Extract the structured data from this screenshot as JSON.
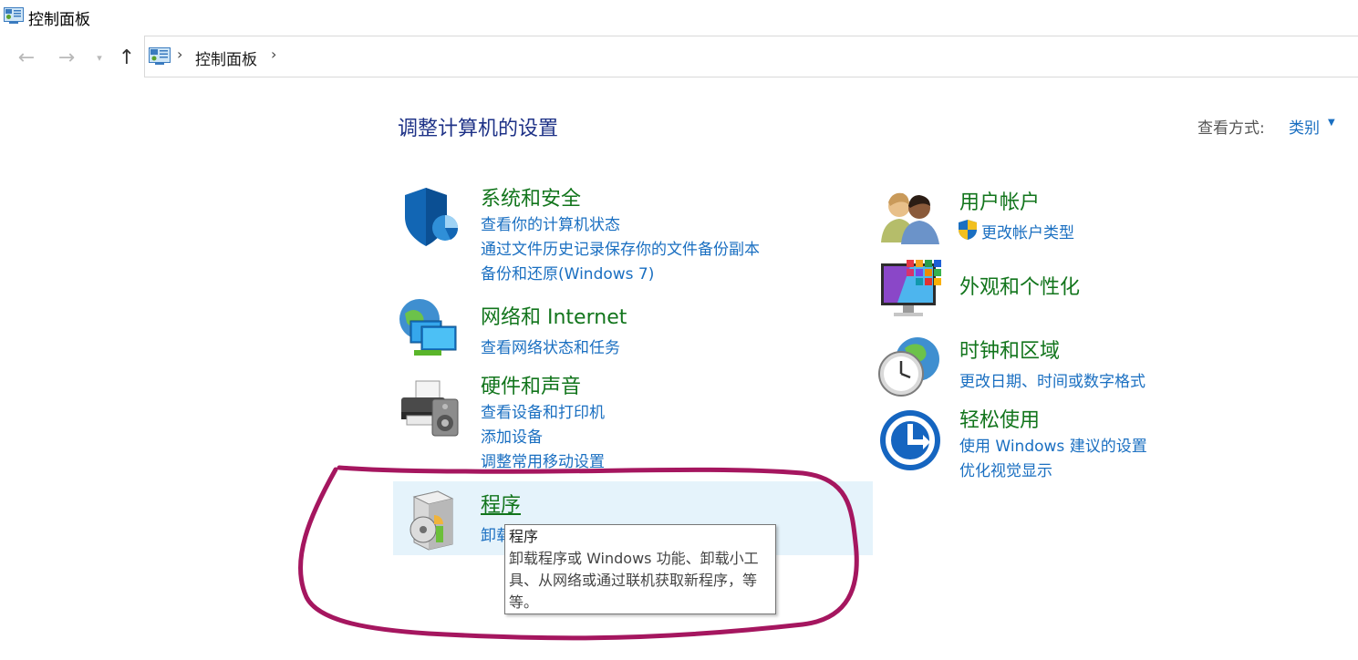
{
  "window": {
    "title": "控制面板"
  },
  "navigation": {
    "back_icon": "arrow-left-icon",
    "forward_icon": "arrow-right-icon",
    "recent_icon": "chevron-down-icon",
    "up_icon": "arrow-up-icon"
  },
  "address": {
    "crumbs": [
      "控制面板"
    ]
  },
  "header": {
    "title": "调整计算机的设置",
    "view_by_label": "查看方式:",
    "view_by_value": "类别"
  },
  "categories": [
    {
      "title": "系统和安全",
      "icon": "shield-icon",
      "links": [
        "查看你的计算机状态",
        "通过文件历史记录保存你的文件备份副本",
        "备份和还原(Windows 7)"
      ]
    },
    {
      "title": "网络和 Internet",
      "icon": "network-icon",
      "links": [
        "查看网络状态和任务"
      ]
    },
    {
      "title": "硬件和声音",
      "icon": "printer-icon",
      "links": [
        "查看设备和打印机",
        "添加设备",
        "调整常用移动设置"
      ]
    },
    {
      "title": "程序",
      "icon": "programs-icon",
      "links": [
        "卸载程序"
      ]
    },
    {
      "title": "用户帐户",
      "icon": "users-icon",
      "links": [
        "更改帐户类型"
      ],
      "link_icon": "uac-shield-icon"
    },
    {
      "title": "外观和个性化",
      "icon": "monitor-colors-icon",
      "links": []
    },
    {
      "title": "时钟和区域",
      "icon": "clock-globe-icon",
      "links": [
        "更改日期、时间或数字格式"
      ]
    },
    {
      "title": "轻松使用",
      "icon": "ease-of-access-icon",
      "links": [
        "使用 Windows 建议的设置",
        "优化视觉显示"
      ]
    }
  ],
  "tooltip": {
    "title": "程序",
    "body": "卸载程序或 Windows 功能、卸载小工具、从网络或通过联机获取新程序，等等。"
  },
  "colors": {
    "title_blue": "#1e3287",
    "link_blue": "#1a6fc1",
    "category_green": "#12751c",
    "hover_bg": "#e5f3fb",
    "annotation": "#a5165f"
  }
}
